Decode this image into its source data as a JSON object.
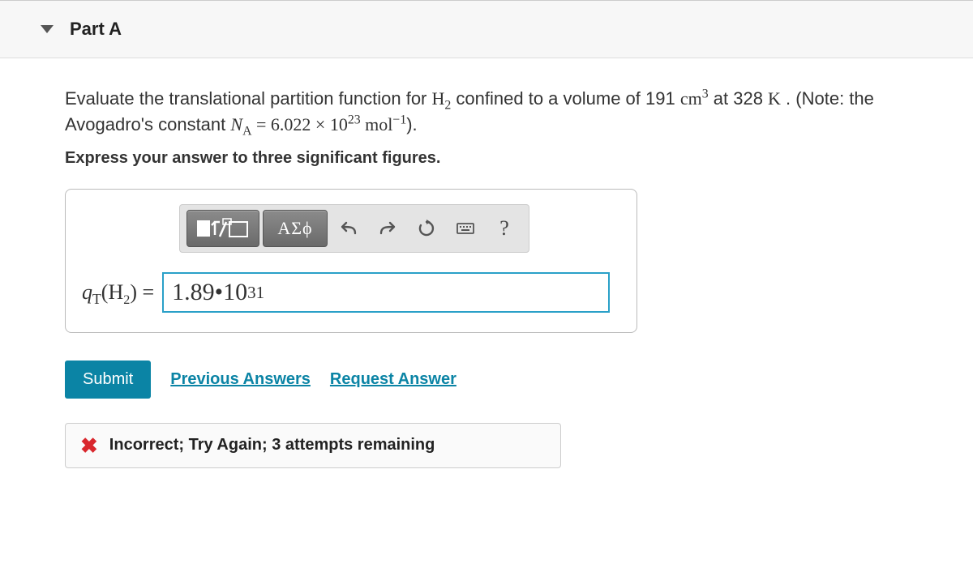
{
  "part": {
    "label": "Part A"
  },
  "question": {
    "pre": "Evaluate the translational partition function for ",
    "molecule_base": "H",
    "molecule_sub": "2",
    "mid1": " confined to a volume of 191 ",
    "unit_cm": "cm",
    "unit_cm_sup": "3",
    "mid2": " at 328 ",
    "temp_unit": "K",
    "mid3": " . (Note: the Avogadro's constant ",
    "na_sym": "N",
    "na_sub": "A",
    "eq": " = 6.022 × 10",
    "eq_sup": "23",
    "mol": " mol",
    "mol_sup": "−1",
    "end": ")."
  },
  "instruction": "Express your answer to three significant figures.",
  "toolbar": {
    "template_icon": "template-icon",
    "greek_label": "ΑΣϕ",
    "help_label": "?"
  },
  "answer": {
    "lhs_q": "q",
    "lhs_T": "T",
    "lhs_open": "(",
    "lhs_H": "H",
    "lhs_2": "2",
    "lhs_close": ") = ",
    "value_mantissa": "1.89",
    "value_dot": " • ",
    "value_base": "10",
    "value_exp": "31"
  },
  "actions": {
    "submit": "Submit",
    "previous": "Previous Answers",
    "request": "Request Answer"
  },
  "feedback": {
    "icon": "✖",
    "text": "Incorrect; Try Again; 3 attempts remaining"
  }
}
